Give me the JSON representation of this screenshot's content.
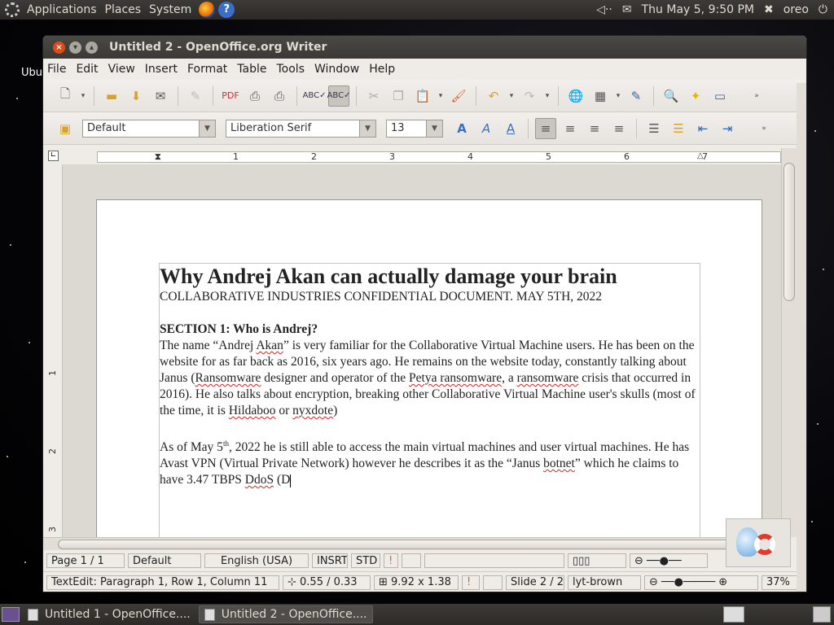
{
  "top_panel": {
    "menus": [
      "Applications",
      "Places",
      "System"
    ],
    "clock": "Thu May  5,  9:50 PM",
    "user": "oreo"
  },
  "desktop": {
    "label": "Ubu"
  },
  "window": {
    "title": "Untitled 2 - OpenOffice.org Writer",
    "menu": [
      "File",
      "Edit",
      "View",
      "Insert",
      "Format",
      "Table",
      "Tools",
      "Window",
      "Help"
    ],
    "formatting": {
      "style": "Default",
      "font": "Liberation Serif",
      "size": "13"
    },
    "ruler_numbers": [
      "1",
      "2",
      "3",
      "4",
      "5",
      "6",
      "7"
    ],
    "vruler_numbers": [
      "1",
      "2",
      "3"
    ]
  },
  "document": {
    "title": "Why Andrej Akan can actually damage your brain",
    "subtitle": "COLLABORATIVE INDUSTRIES CONFIDENTIAL DOCUMENT. MAY 5TH, 2022",
    "section1_heading": "SECTION 1: Who is Andrej?",
    "para1_a": "The name “Andrej ",
    "para1_b": "Akan",
    "para1_c": "” is very familiar for the Collaborative Virtual Machine users. He has been on the website for as far back as 2016, six years ago. He remains on the website today, constantly talking about Janus (",
    "para1_d": "Ransomware",
    "para1_e": " designer and operator of the ",
    "para1_f": "Petya ransomware",
    "para1_g": ", a ",
    "para1_h": "ransomware",
    "para1_i": " crisis that occurred in 2016). He also talks about encryption, breaking other Collaborative Virtual Machine user's skulls (most of the time, it is ",
    "para1_j": "Hildaboo",
    "para1_k": " or ",
    "para1_l": "nyxdote",
    "para1_m": ")",
    "para2_a": "As of May 5",
    "para2_sup": "th",
    "para2_b": ", 2022 he is still able to access the main virtual machines and user virtual machines. He has Avast VPN (Virtual Private Network) however he describes it as the “Janus ",
    "para2_c": "botnet",
    "para2_d": "” which he claims to have 3.47 TBPS ",
    "para2_e": "DdoS",
    "para2_f": " (D"
  },
  "status1": {
    "page": "Page 1 / 1",
    "style": "Default",
    "language": "English (USA)",
    "insert": "INSRT",
    "selection": "STD"
  },
  "status2": {
    "context": "TextEdit: Paragraph 1, Row 1, Column 11",
    "position": "0.55 / 0.33",
    "size": "9.92 x 1.38",
    "slide": "Slide 2 / 2",
    "theme": "lyt-brown",
    "zoom": "37%"
  },
  "taskbar": {
    "tasks": [
      "Untitled 1 - OpenOffice....",
      "Untitled 2 - OpenOffice...."
    ]
  }
}
